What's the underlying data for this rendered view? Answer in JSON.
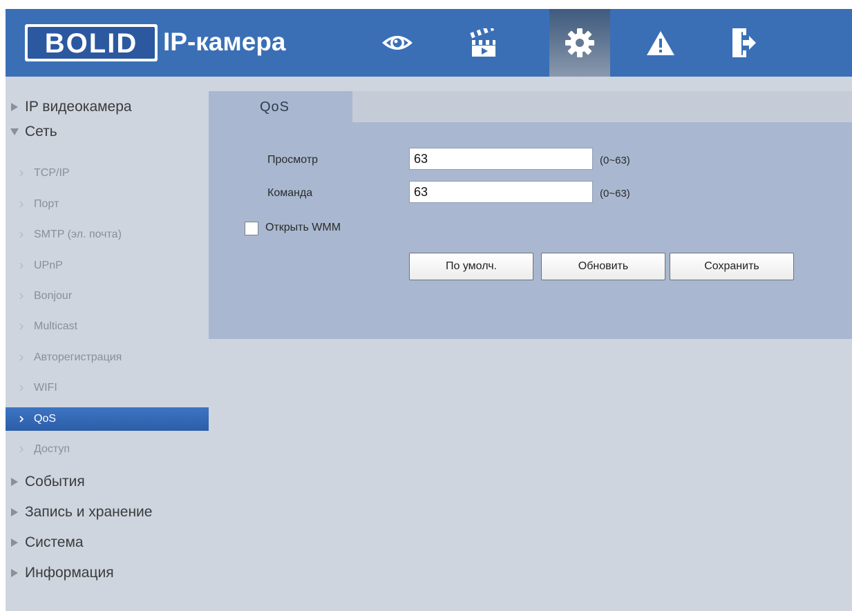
{
  "header": {
    "logo_text": "BOLID",
    "title": "IP-камера",
    "nav": [
      {
        "icon": "eye-icon",
        "label": ""
      },
      {
        "icon": "clapperboard-icon",
        "label": ""
      },
      {
        "icon": "gear-icon",
        "label": "",
        "active": true
      },
      {
        "icon": "warning-icon",
        "label": ""
      },
      {
        "icon": "logout-icon",
        "label": ""
      }
    ]
  },
  "sidebar": {
    "groups": [
      {
        "label": "IP видеокамера",
        "expanded": false
      },
      {
        "label": "Сеть",
        "expanded": true,
        "items": [
          {
            "label": "TCP/IP"
          },
          {
            "label": "Порт"
          },
          {
            "label": "SMTP (эл. почта)"
          },
          {
            "label": "UPnP"
          },
          {
            "label": "Bonjour"
          },
          {
            "label": "Multicast"
          },
          {
            "label": "Авторегистрация"
          },
          {
            "label": "WIFI"
          },
          {
            "label": "QoS",
            "active": true
          },
          {
            "label": "Доступ"
          }
        ]
      },
      {
        "label": "События",
        "expanded": false
      },
      {
        "label": "Запись и хранение",
        "expanded": false
      },
      {
        "label": "Система",
        "expanded": false
      },
      {
        "label": "Информация",
        "expanded": false
      }
    ]
  },
  "tab": {
    "label": "QoS"
  },
  "form": {
    "view": {
      "label": "Просмотр",
      "value": "63",
      "range": "(0~63)"
    },
    "command": {
      "label": "Команда",
      "value": "63",
      "range": "(0~63)"
    },
    "wmm": {
      "label": "Открыть WMM",
      "checked": false
    },
    "buttons": {
      "default": "По умолч.",
      "refresh": "Обновить",
      "save": "Сохранить"
    }
  },
  "colors": {
    "header_bg": "#3a6fb6",
    "page_bg": "#ced5df",
    "panel_bg": "#a9b8d0",
    "active_item": "#3068b4"
  }
}
